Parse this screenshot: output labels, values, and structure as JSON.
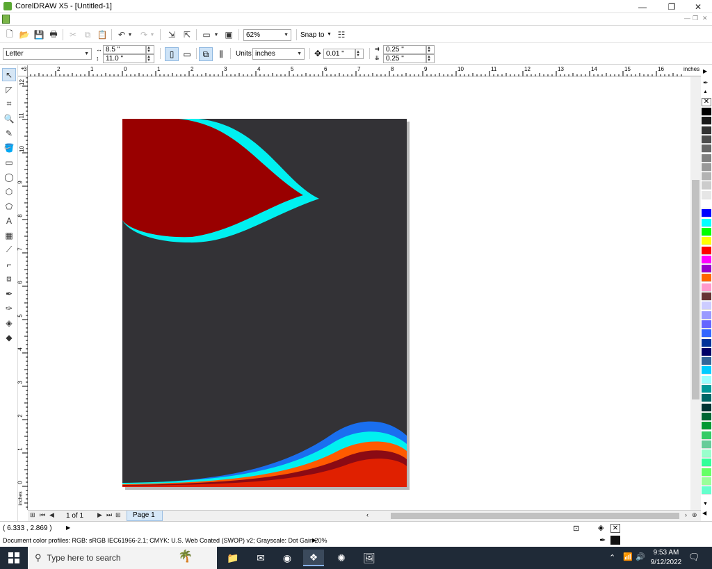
{
  "window": {
    "title": "CorelDRAW X5 - [Untitled-1]",
    "minimize_glyph": "—",
    "restore_glyph": "❐",
    "close_glyph": "✕"
  },
  "toolbar": {
    "zoom_value": "62%",
    "snap_label": "Snap to"
  },
  "property_bar": {
    "paper_size": "Letter",
    "width": "8.5 \"",
    "height": "11.0 \"",
    "units_label": "Units:",
    "units_value": "inches",
    "nudge": "0.01 \"",
    "dup_x": "0.25 \"",
    "dup_y": "0.25 \""
  },
  "rulers": {
    "h_unit": "inches",
    "v_unit": "inches",
    "h_labels": [
      "3",
      "2",
      "1",
      "0",
      "1",
      "2",
      "3",
      "4",
      "5",
      "6",
      "7",
      "8",
      "9",
      "10",
      "11",
      "12",
      "13",
      "14",
      "15",
      "16"
    ],
    "v_labels": [
      "12",
      "11",
      "10",
      "9",
      "8",
      "7",
      "6",
      "5",
      "4",
      "3",
      "2",
      "1",
      "0"
    ]
  },
  "page_nav": {
    "page_count": "1 of 1",
    "page_tab": "Page 1"
  },
  "status": {
    "coordinates": "( 6.333 , 2.869 )",
    "color_profiles": "Document color profiles: RGB: sRGB IEC61966-2.1; CMYK: U.S. Web Coated (SWOP) v2; Grayscale: Dot Gain 20%"
  },
  "taskbar": {
    "search_placeholder": "Type here to search",
    "time": "9:53 AM",
    "date": "9/12/2022"
  },
  "palette_colors": [
    "#000000",
    "#1a1a1a",
    "#333333",
    "#4d4d4d",
    "#666666",
    "#808080",
    "#999999",
    "#b3b3b3",
    "#cccccc",
    "#e6e6e6",
    "#ffffff",
    "#0000ff",
    "#00ffff",
    "#00ff00",
    "#ffff00",
    "#ff0000",
    "#ff00ff",
    "#9900cc",
    "#ff6600",
    "#ff99cc",
    "#663333",
    "#ccccff",
    "#9999ff",
    "#6666ff",
    "#3366ff",
    "#003399",
    "#000066",
    "#336699",
    "#00ccff",
    "#99ffff",
    "#009999",
    "#006666",
    "#003333",
    "#006633",
    "#009933",
    "#33cc66",
    "#66cc99",
    "#99ffcc",
    "#33ff99",
    "#66ff66",
    "#99ff99",
    "#66ffcc"
  ],
  "artwork_colors": {
    "page_bg": "#333236",
    "leaf_red": "#990000",
    "accent_cyan": "#00f0f0",
    "wave_blue": "#1a6ff0",
    "wave_orange": "#ff5a00",
    "wave_darkred": "#8b0a14",
    "wave_red": "#e02000"
  }
}
